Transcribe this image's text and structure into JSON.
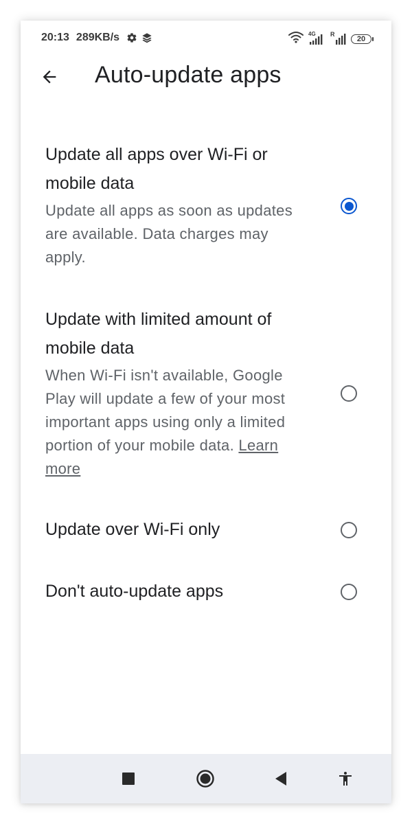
{
  "status_bar": {
    "time": "20:13",
    "speed": "289KB/s",
    "network_label": "4G",
    "roaming_label": "R",
    "battery": "20",
    "icons": [
      "settings-gear-icon",
      "layers-icon",
      "wifi-icon",
      "signal-4g-icon",
      "signal-roaming-icon",
      "battery-icon"
    ]
  },
  "header": {
    "title": "Auto-update apps",
    "back_icon": "arrow-left-icon"
  },
  "options": [
    {
      "title": "Update all apps over Wi-Fi or mobile data",
      "description": "Update all apps as soon as updates are available. Data charges may apply.",
      "selected": true
    },
    {
      "title": "Update with limited amount of mobile data",
      "description": "When Wi-Fi isn't available, Google Play will update a few of your most important apps using only a limited portion of your mobile data.",
      "link": "Learn more",
      "selected": false
    },
    {
      "title": "Update over Wi-Fi only",
      "selected": false
    },
    {
      "title": "Don't auto-update apps",
      "selected": false
    }
  ],
  "nav_bar": {
    "icons": [
      "recents-square-icon",
      "home-circle-icon",
      "back-triangle-icon",
      "accessibility-icon"
    ]
  },
  "colors": {
    "accent": "#0b57d0",
    "title_text": "#202124",
    "secondary_text": "#5f6368",
    "nav_bar_bg": "#eceef3"
  }
}
